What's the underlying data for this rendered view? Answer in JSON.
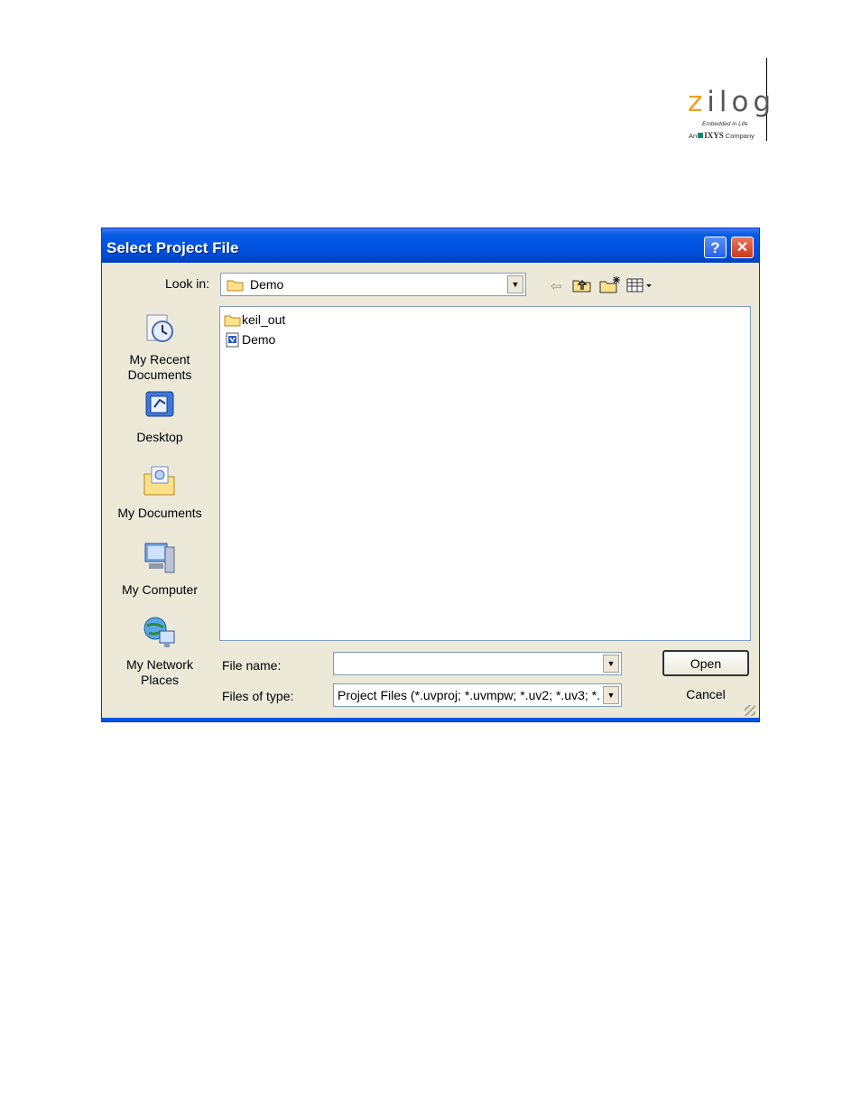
{
  "logo": {
    "z": "z",
    "rest": "ilog",
    "tagline": "Embedded in Life",
    "company_prefix": "An",
    "company_name": "IXYS",
    "company_suffix": "Company"
  },
  "dialog": {
    "title": "Select Project File",
    "help_glyph": "?",
    "close_glyph": "✕",
    "look_in_label": "Look in:",
    "look_in_value": "Demo",
    "toolbar_icons": [
      "back-icon",
      "up-folder-icon",
      "new-folder-icon",
      "view-menu-icon"
    ],
    "places": [
      {
        "label_line1": "My Recent",
        "label_line2": "Documents",
        "icon": "recent-documents-icon"
      },
      {
        "label_line1": "Desktop",
        "label_line2": "",
        "icon": "desktop-icon"
      },
      {
        "label_line1": "My Documents",
        "label_line2": "",
        "icon": "my-documents-icon"
      },
      {
        "label_line1": "My Computer",
        "label_line2": "",
        "icon": "my-computer-icon"
      },
      {
        "label_line1": "My Network",
        "label_line2": "Places",
        "icon": "network-places-icon"
      }
    ],
    "files": [
      {
        "name": "keil_out",
        "icon": "folder-icon"
      },
      {
        "name": "Demo",
        "icon": "project-file-icon"
      }
    ],
    "file_name_label": "File name:",
    "file_name_value": "",
    "files_of_type_label": "Files of type:",
    "files_of_type_value": "Project Files (*.uvproj; *.uvmpw; *.uv2; *.uv3; *.",
    "open_label": "Open",
    "cancel_label": "Cancel"
  }
}
